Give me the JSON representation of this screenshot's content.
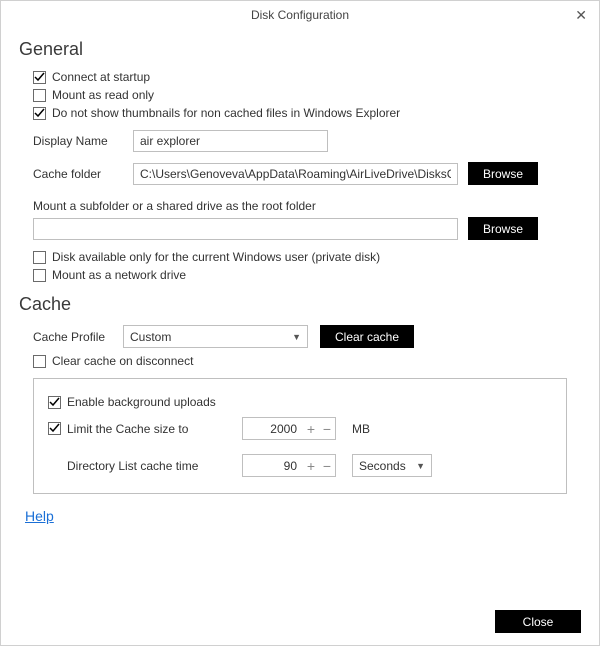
{
  "window": {
    "title": "Disk Configuration"
  },
  "sections": {
    "general": "General",
    "cache": "Cache"
  },
  "general": {
    "connect_at_startup": {
      "label": "Connect at startup",
      "checked": true
    },
    "mount_read_only": {
      "label": "Mount as read only",
      "checked": false
    },
    "no_thumbnails": {
      "label": "Do not show thumbnails for non cached files in Windows Explorer",
      "checked": true
    },
    "display_name": {
      "label": "Display Name",
      "value": "air explorer"
    },
    "cache_folder": {
      "label": "Cache folder",
      "value": "C:\\Users\\Genoveva\\AppData\\Roaming\\AirLiveDrive\\DisksCa",
      "button": "Browse"
    },
    "mount_subfolder": {
      "label": "Mount a subfolder or a shared drive as the root folder",
      "value": "",
      "button": "Browse"
    },
    "private_disk": {
      "label": "Disk available only for the current Windows user (private disk)",
      "checked": false
    },
    "network_drive": {
      "label": "Mount as a network drive",
      "checked": false
    }
  },
  "cache": {
    "profile_label": "Cache Profile",
    "profile_value": "Custom",
    "clear_button": "Clear cache",
    "clear_on_disconnect": {
      "label": "Clear cache on disconnect",
      "checked": false
    },
    "enable_bg_uploads": {
      "label": "Enable background uploads",
      "checked": true
    },
    "limit_size": {
      "label": "Limit the Cache size to",
      "checked": true,
      "value": "2000",
      "unit": "MB"
    },
    "dir_list_time": {
      "label": "Directory List cache time",
      "value": "90",
      "unit": "Seconds"
    }
  },
  "help": "Help",
  "footer": {
    "close": "Close"
  }
}
